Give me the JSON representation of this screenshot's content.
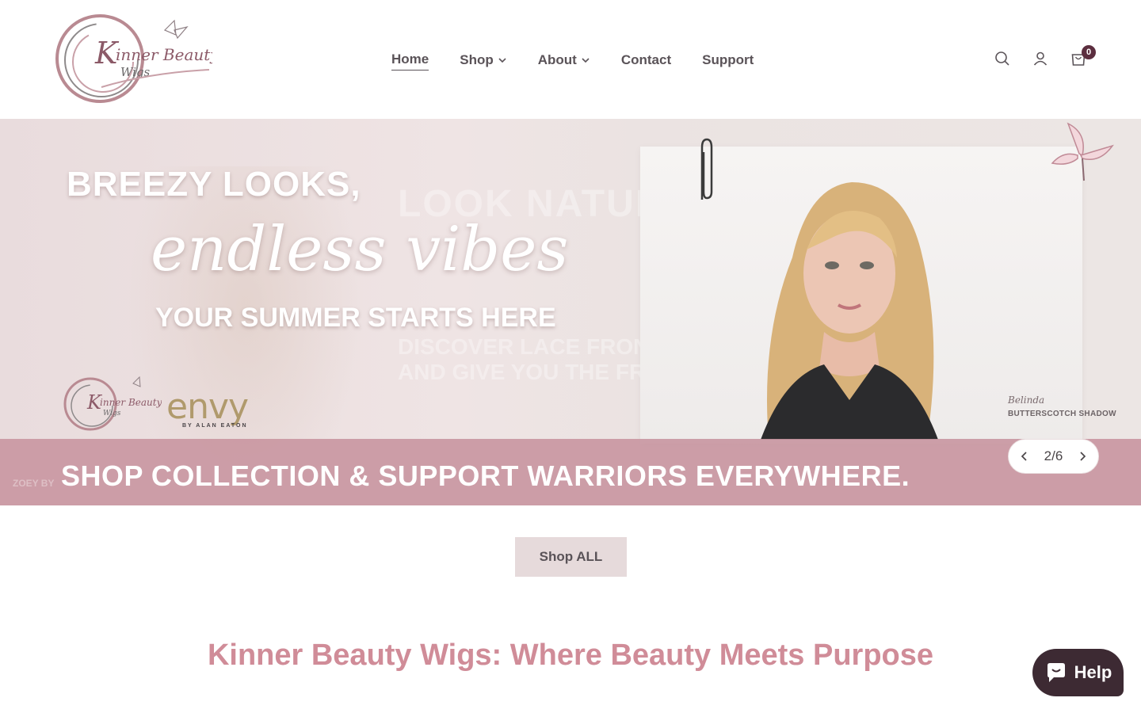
{
  "header": {
    "logo_text": "Kinner Beauty Wigs",
    "nav": [
      {
        "label": "Home",
        "active": true
      },
      {
        "label": "Shop",
        "dropdown": true
      },
      {
        "label": "About",
        "dropdown": true
      },
      {
        "label": "Contact"
      },
      {
        "label": "Support"
      }
    ],
    "icons": [
      "search-icon",
      "account-icon",
      "cart-icon"
    ],
    "cart_count": "0"
  },
  "hero": {
    "headline_1": "BREEZY LOOKS,",
    "headline_2": "endless vibes",
    "headline_3": "YOUR SUMMER STARTS HERE",
    "brand_partner": "envy",
    "brand_partner_sub": "BY ALAN EATON",
    "product_name": "Belinda",
    "product_shade": "BUTTERSCOTCH SHADOW",
    "banner_text": "SHOP COLLECTION & SUPPORT WARRIORS EVERYWHERE.",
    "slide_counter": "2/6"
  },
  "shop_all_label": "Shop ALL",
  "section_title": "Kinner Beauty Wigs: Where Beauty Meets Purpose",
  "help_label": "Help",
  "colors": {
    "accent_pink": "#d08c98",
    "banner_pink": "#c997a2",
    "help_dark": "#3d2a33",
    "button_bg": "#e6dadb"
  }
}
